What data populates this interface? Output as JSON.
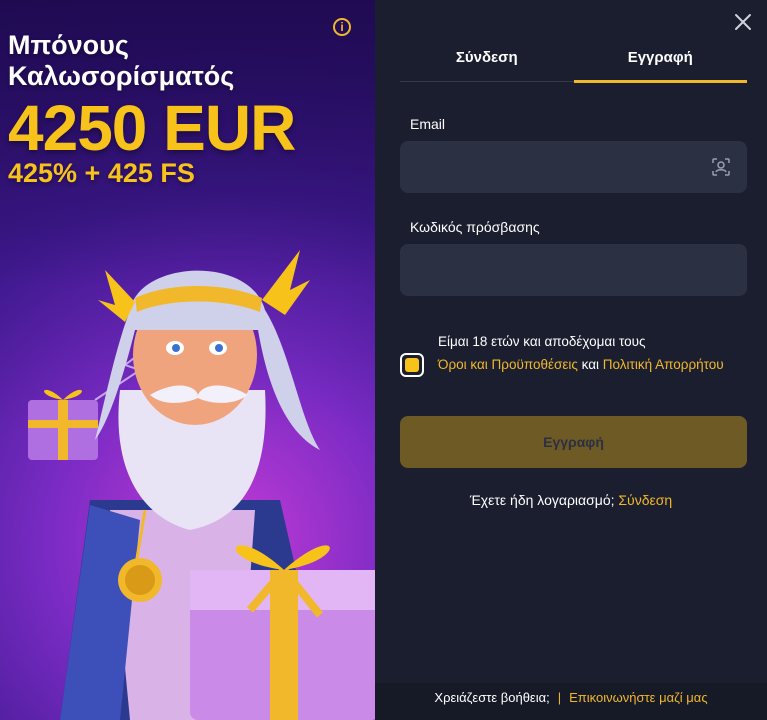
{
  "promo": {
    "title": "Μπόνους Καλωσορίσματός",
    "amount": "4250 EUR",
    "subtitle": "425% + 425 FS",
    "info_icon": "info-icon"
  },
  "tabs": [
    {
      "label": "Σύνδεση",
      "active": false
    },
    {
      "label": "Εγγραφή",
      "active": true
    }
  ],
  "form": {
    "email_label": "Email",
    "email_value": "",
    "email_icon": "face-scan-icon",
    "password_label": "Κωδικός πρόσβασης",
    "password_value": "",
    "checkbox_checked": true,
    "terms_prefix": "Είμαι 18 ετών και αποδέχομαι τους",
    "terms_link": "Όροι και Προϋποθέσεις",
    "terms_and": "και",
    "privacy_link": "Πολιτική Απορρήτου",
    "submit_label": "Εγγραφή",
    "have_account": "Έχετε ήδη λογαριασμό;",
    "login_link": "Σύνδεση"
  },
  "footer": {
    "help_text": "Χρειάζεστε βοήθεια;",
    "separator": "|",
    "contact_link": "Επικοινωνήστε μαζί μας"
  },
  "colors": {
    "accent": "#f2b82c",
    "panel_bg": "#1b1e2e",
    "input_bg": "#2c3043",
    "button_bg": "#6e5a25"
  }
}
